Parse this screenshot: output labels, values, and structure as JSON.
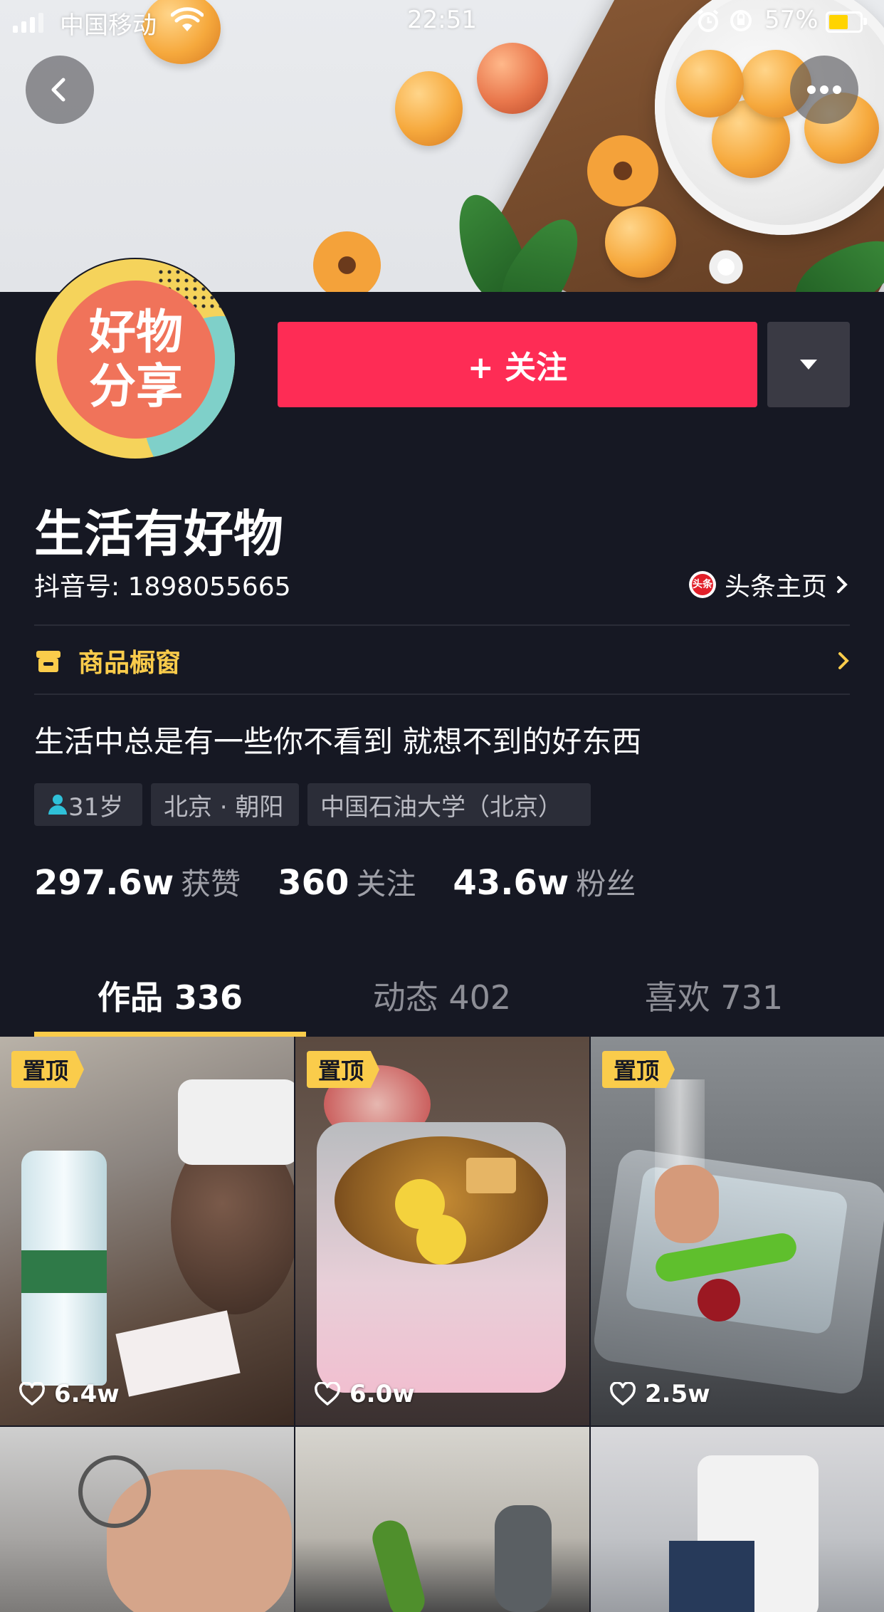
{
  "status_bar": {
    "carrier": "中国移动",
    "time": "22:51",
    "battery": "57%"
  },
  "profile": {
    "name": "生活有好物",
    "douyin_id": "抖音号: 1898055665",
    "toutiao_link": "头条主页",
    "toutiao_icon_text": "头条",
    "avatar_line1": "好物",
    "avatar_line2": "分享",
    "follow_label": "+ 关注",
    "shop_label": "商品橱窗",
    "bio": "生活中总是有一些你不看到 就想不到的好东西",
    "tags": {
      "age": "31岁",
      "location": "北京 · 朝阳",
      "school": "中国石油大学（北京）"
    },
    "stats": {
      "likes_value": "297.6w",
      "likes_label": "获赞",
      "following_value": "360",
      "following_label": "关注",
      "followers_value": "43.6w",
      "followers_label": "粉丝"
    }
  },
  "tabs": {
    "works": "作品 336",
    "activity": "动态 402",
    "likes": "喜欢 731"
  },
  "videos": [
    {
      "pinned": "置顶",
      "likes": "6.4w"
    },
    {
      "pinned": "置顶",
      "likes": "6.0w"
    },
    {
      "pinned": "置顶",
      "likes": "2.5w"
    }
  ],
  "colors": {
    "background": "#161823",
    "follow": "#fe2c55",
    "accent": "#facc4b"
  }
}
